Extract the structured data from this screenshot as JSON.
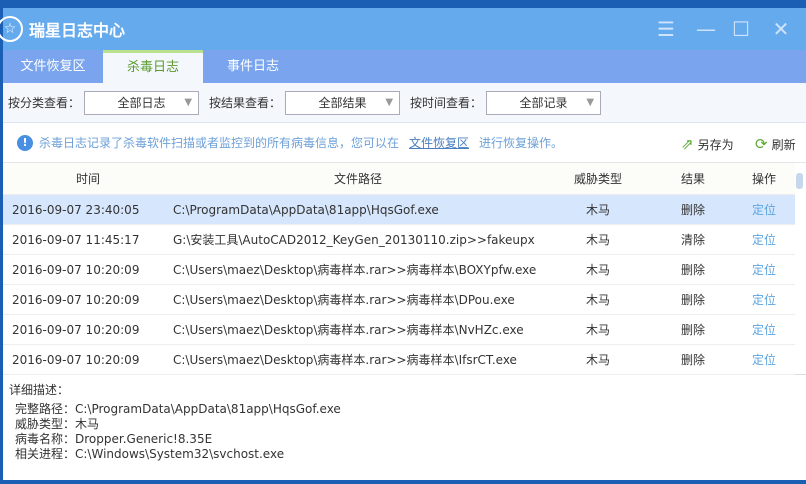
{
  "window": {
    "title": "瑞星日志中心"
  },
  "tabs": [
    {
      "label": "文件恢复区"
    },
    {
      "label": "杀毒日志"
    },
    {
      "label": "事件日志"
    }
  ],
  "filters": [
    {
      "label": "按分类查看：",
      "value": "全部日志"
    },
    {
      "label": "按结果查看：",
      "value": "全部结果"
    },
    {
      "label": "按时间查看：",
      "value": "全部记录"
    }
  ],
  "info": {
    "text_before": "杀毒日志记录了杀毒软件扫描或者监控到的所有病毒信息，您可以在",
    "link": "文件恢复区",
    "text_after": "进行恢复操作。"
  },
  "toolbar": {
    "save_as": "另存为",
    "refresh": "刷新"
  },
  "table": {
    "headers": [
      "时间",
      "文件路径",
      "威胁类型",
      "结果",
      "操作"
    ],
    "rows": [
      [
        "2016-09-07 23:40:05",
        "C:\\ProgramData\\AppData\\81app\\HqsGof.exe",
        "木马",
        "删除",
        "定位"
      ],
      [
        "2016-09-07 11:45:17",
        "G:\\安装工具\\AutoCAD2012_KeyGen_20130110.zip>>fakeupx",
        "木马",
        "清除",
        "定位"
      ],
      [
        "2016-09-07 10:20:09",
        "C:\\Users\\maez\\Desktop\\病毒样本.rar>>病毒样本\\BOXYpfw.exe",
        "木马",
        "删除",
        "定位"
      ],
      [
        "2016-09-07 10:20:09",
        "C:\\Users\\maez\\Desktop\\病毒样本.rar>>病毒样本\\DPou.exe",
        "木马",
        "删除",
        "定位"
      ],
      [
        "2016-09-07 10:20:09",
        "C:\\Users\\maez\\Desktop\\病毒样本.rar>>病毒样本\\NvHZc.exe",
        "木马",
        "删除",
        "定位"
      ],
      [
        "2016-09-07 10:20:09",
        "C:\\Users\\maez\\Desktop\\病毒样本.rar>>病毒样本\\IfsrCT.exe",
        "木马",
        "删除",
        "定位"
      ]
    ]
  },
  "detail": {
    "title": "详细描述：",
    "lines": [
      "完整路径：C:\\ProgramData\\AppData\\81app\\HqsGof.exe",
      "威胁类型：木马",
      "病毒名称：Dropper.Generic!8.35E",
      "相关进程：C:\\Windows\\System32\\svchost.exe"
    ]
  }
}
